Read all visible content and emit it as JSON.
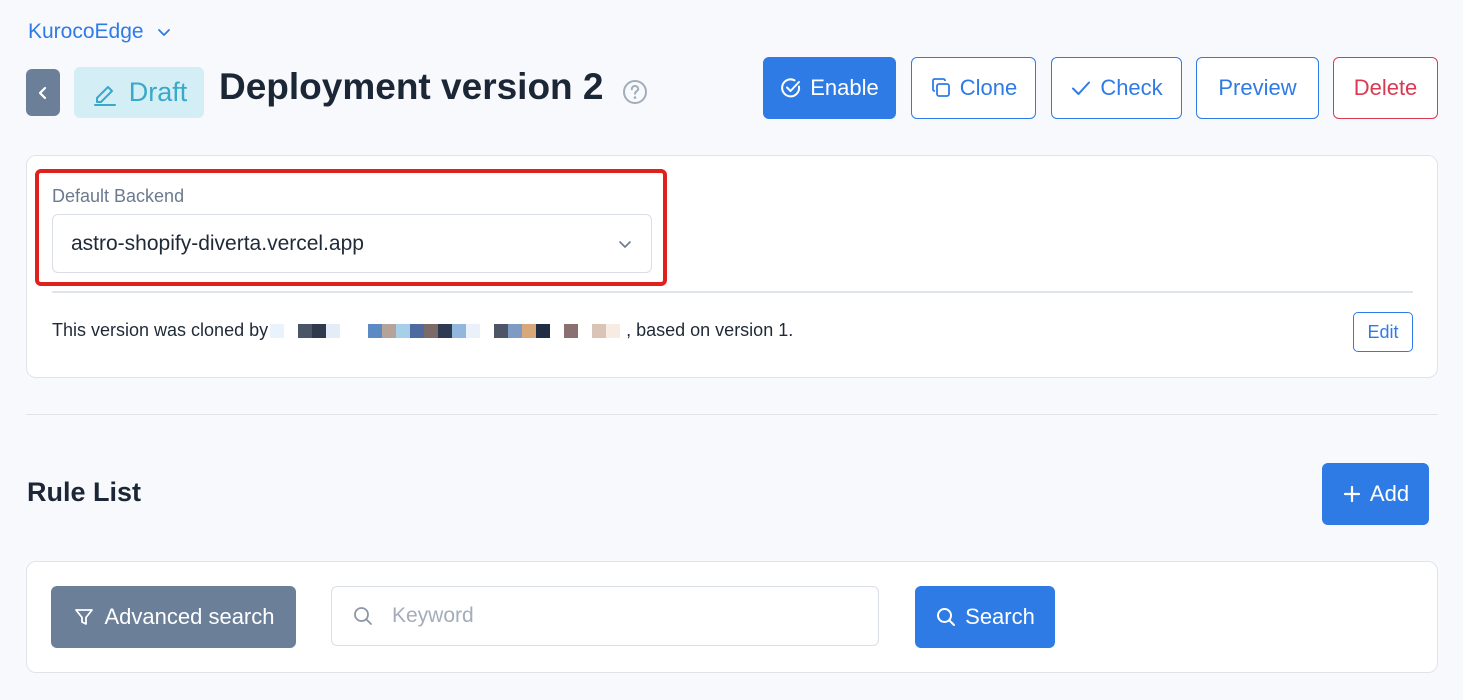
{
  "workspace": {
    "name": "KurocoEdge",
    "icon": "chevron-down-icon"
  },
  "header": {
    "back_icon": "chevron-left-icon",
    "badge": {
      "label": "Draft",
      "icon": "pencil-icon"
    },
    "title": "Deployment version 2",
    "help_icon": "question-circle-icon"
  },
  "actions": {
    "enable": {
      "label": "Enable",
      "icon": "check-circle-icon"
    },
    "clone": {
      "label": "Clone",
      "icon": "copy-icon"
    },
    "check": {
      "label": "Check",
      "icon": "check-icon"
    },
    "preview": {
      "label": "Preview"
    },
    "delete": {
      "label": "Delete"
    }
  },
  "backend": {
    "label": "Default Backend",
    "selected": "astro-shopify-diverta.vercel.app",
    "clone_prefix": "This version was cloned by",
    "clone_suffix": ", based on version 1.",
    "edit_label": "Edit"
  },
  "rules": {
    "title": "Rule List",
    "add_label": "Add",
    "advanced_search_label": "Advanced search",
    "keyword_placeholder": "Keyword",
    "keyword_value": "",
    "search_label": "Search"
  },
  "colors": {
    "primary": "#2f7be5",
    "danger": "#d83a52",
    "secondary": "#6b7f99",
    "draft_bg": "#d4eef6",
    "draft_text": "#3aa8c9",
    "highlight": "#e0201a"
  }
}
